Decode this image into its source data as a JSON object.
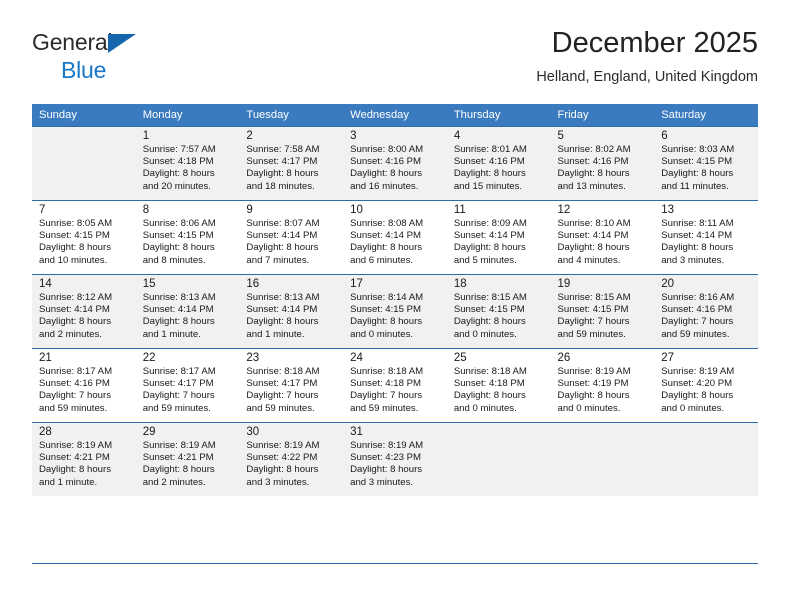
{
  "brand": {
    "line1": "General",
    "line2": "Blue",
    "triangle_color": "#1566ad",
    "blue_color": "#1878c8"
  },
  "header": {
    "month_title": "December 2025",
    "location": "Helland, England, United Kingdom"
  },
  "calendar": {
    "header_background": "#3a7bbf",
    "grid_line_color": "#2e6da4",
    "shaded_row_background": "#f1f1f1",
    "weekdays": [
      "Sunday",
      "Monday",
      "Tuesday",
      "Wednesday",
      "Thursday",
      "Friday",
      "Saturday"
    ],
    "weeks": [
      {
        "shaded": true,
        "days": [
          {
            "num": "",
            "info": ""
          },
          {
            "num": "1",
            "info": "Sunrise: 7:57 AM\nSunset: 4:18 PM\nDaylight: 8 hours\nand 20 minutes."
          },
          {
            "num": "2",
            "info": "Sunrise: 7:58 AM\nSunset: 4:17 PM\nDaylight: 8 hours\nand 18 minutes."
          },
          {
            "num": "3",
            "info": "Sunrise: 8:00 AM\nSunset: 4:16 PM\nDaylight: 8 hours\nand 16 minutes."
          },
          {
            "num": "4",
            "info": "Sunrise: 8:01 AM\nSunset: 4:16 PM\nDaylight: 8 hours\nand 15 minutes."
          },
          {
            "num": "5",
            "info": "Sunrise: 8:02 AM\nSunset: 4:16 PM\nDaylight: 8 hours\nand 13 minutes."
          },
          {
            "num": "6",
            "info": "Sunrise: 8:03 AM\nSunset: 4:15 PM\nDaylight: 8 hours\nand 11 minutes."
          }
        ]
      },
      {
        "shaded": false,
        "days": [
          {
            "num": "7",
            "info": "Sunrise: 8:05 AM\nSunset: 4:15 PM\nDaylight: 8 hours\nand 10 minutes."
          },
          {
            "num": "8",
            "info": "Sunrise: 8:06 AM\nSunset: 4:15 PM\nDaylight: 8 hours\nand 8 minutes."
          },
          {
            "num": "9",
            "info": "Sunrise: 8:07 AM\nSunset: 4:14 PM\nDaylight: 8 hours\nand 7 minutes."
          },
          {
            "num": "10",
            "info": "Sunrise: 8:08 AM\nSunset: 4:14 PM\nDaylight: 8 hours\nand 6 minutes."
          },
          {
            "num": "11",
            "info": "Sunrise: 8:09 AM\nSunset: 4:14 PM\nDaylight: 8 hours\nand 5 minutes."
          },
          {
            "num": "12",
            "info": "Sunrise: 8:10 AM\nSunset: 4:14 PM\nDaylight: 8 hours\nand 4 minutes."
          },
          {
            "num": "13",
            "info": "Sunrise: 8:11 AM\nSunset: 4:14 PM\nDaylight: 8 hours\nand 3 minutes."
          }
        ]
      },
      {
        "shaded": true,
        "days": [
          {
            "num": "14",
            "info": "Sunrise: 8:12 AM\nSunset: 4:14 PM\nDaylight: 8 hours\nand 2 minutes."
          },
          {
            "num": "15",
            "info": "Sunrise: 8:13 AM\nSunset: 4:14 PM\nDaylight: 8 hours\nand 1 minute."
          },
          {
            "num": "16",
            "info": "Sunrise: 8:13 AM\nSunset: 4:14 PM\nDaylight: 8 hours\nand 1 minute."
          },
          {
            "num": "17",
            "info": "Sunrise: 8:14 AM\nSunset: 4:15 PM\nDaylight: 8 hours\nand 0 minutes."
          },
          {
            "num": "18",
            "info": "Sunrise: 8:15 AM\nSunset: 4:15 PM\nDaylight: 8 hours\nand 0 minutes."
          },
          {
            "num": "19",
            "info": "Sunrise: 8:15 AM\nSunset: 4:15 PM\nDaylight: 7 hours\nand 59 minutes."
          },
          {
            "num": "20",
            "info": "Sunrise: 8:16 AM\nSunset: 4:16 PM\nDaylight: 7 hours\nand 59 minutes."
          }
        ]
      },
      {
        "shaded": false,
        "days": [
          {
            "num": "21",
            "info": "Sunrise: 8:17 AM\nSunset: 4:16 PM\nDaylight: 7 hours\nand 59 minutes."
          },
          {
            "num": "22",
            "info": "Sunrise: 8:17 AM\nSunset: 4:17 PM\nDaylight: 7 hours\nand 59 minutes."
          },
          {
            "num": "23",
            "info": "Sunrise: 8:18 AM\nSunset: 4:17 PM\nDaylight: 7 hours\nand 59 minutes."
          },
          {
            "num": "24",
            "info": "Sunrise: 8:18 AM\nSunset: 4:18 PM\nDaylight: 7 hours\nand 59 minutes."
          },
          {
            "num": "25",
            "info": "Sunrise: 8:18 AM\nSunset: 4:18 PM\nDaylight: 8 hours\nand 0 minutes."
          },
          {
            "num": "26",
            "info": "Sunrise: 8:19 AM\nSunset: 4:19 PM\nDaylight: 8 hours\nand 0 minutes."
          },
          {
            "num": "27",
            "info": "Sunrise: 8:19 AM\nSunset: 4:20 PM\nDaylight: 8 hours\nand 0 minutes."
          }
        ]
      },
      {
        "shaded": true,
        "days": [
          {
            "num": "28",
            "info": "Sunrise: 8:19 AM\nSunset: 4:21 PM\nDaylight: 8 hours\nand 1 minute."
          },
          {
            "num": "29",
            "info": "Sunrise: 8:19 AM\nSunset: 4:21 PM\nDaylight: 8 hours\nand 2 minutes."
          },
          {
            "num": "30",
            "info": "Sunrise: 8:19 AM\nSunset: 4:22 PM\nDaylight: 8 hours\nand 3 minutes."
          },
          {
            "num": "31",
            "info": "Sunrise: 8:19 AM\nSunset: 4:23 PM\nDaylight: 8 hours\nand 3 minutes."
          },
          {
            "num": "",
            "info": ""
          },
          {
            "num": "",
            "info": ""
          },
          {
            "num": "",
            "info": ""
          }
        ]
      }
    ]
  }
}
